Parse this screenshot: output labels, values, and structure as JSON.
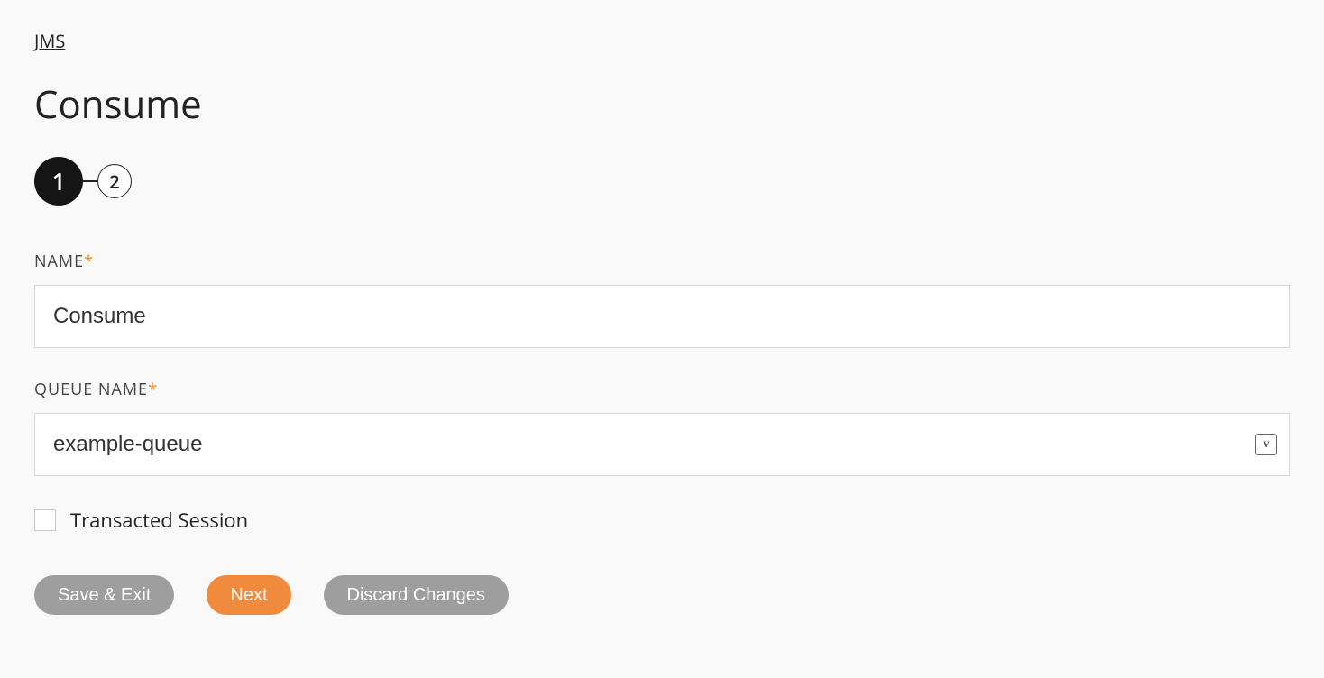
{
  "breadcrumb": {
    "label": "JMS"
  },
  "title": "Consume",
  "stepper": {
    "steps": [
      "1",
      "2"
    ],
    "activeIndex": 0
  },
  "fields": {
    "name": {
      "label": "NAME",
      "required": "*",
      "value": "Consume"
    },
    "queueName": {
      "label": "QUEUE NAME",
      "required": "*",
      "value": "example-queue",
      "variableBadge": "v"
    },
    "transacted": {
      "label": "Transacted Session",
      "checked": false
    }
  },
  "buttons": {
    "saveExit": "Save & Exit",
    "next": "Next",
    "discard": "Discard Changes"
  }
}
